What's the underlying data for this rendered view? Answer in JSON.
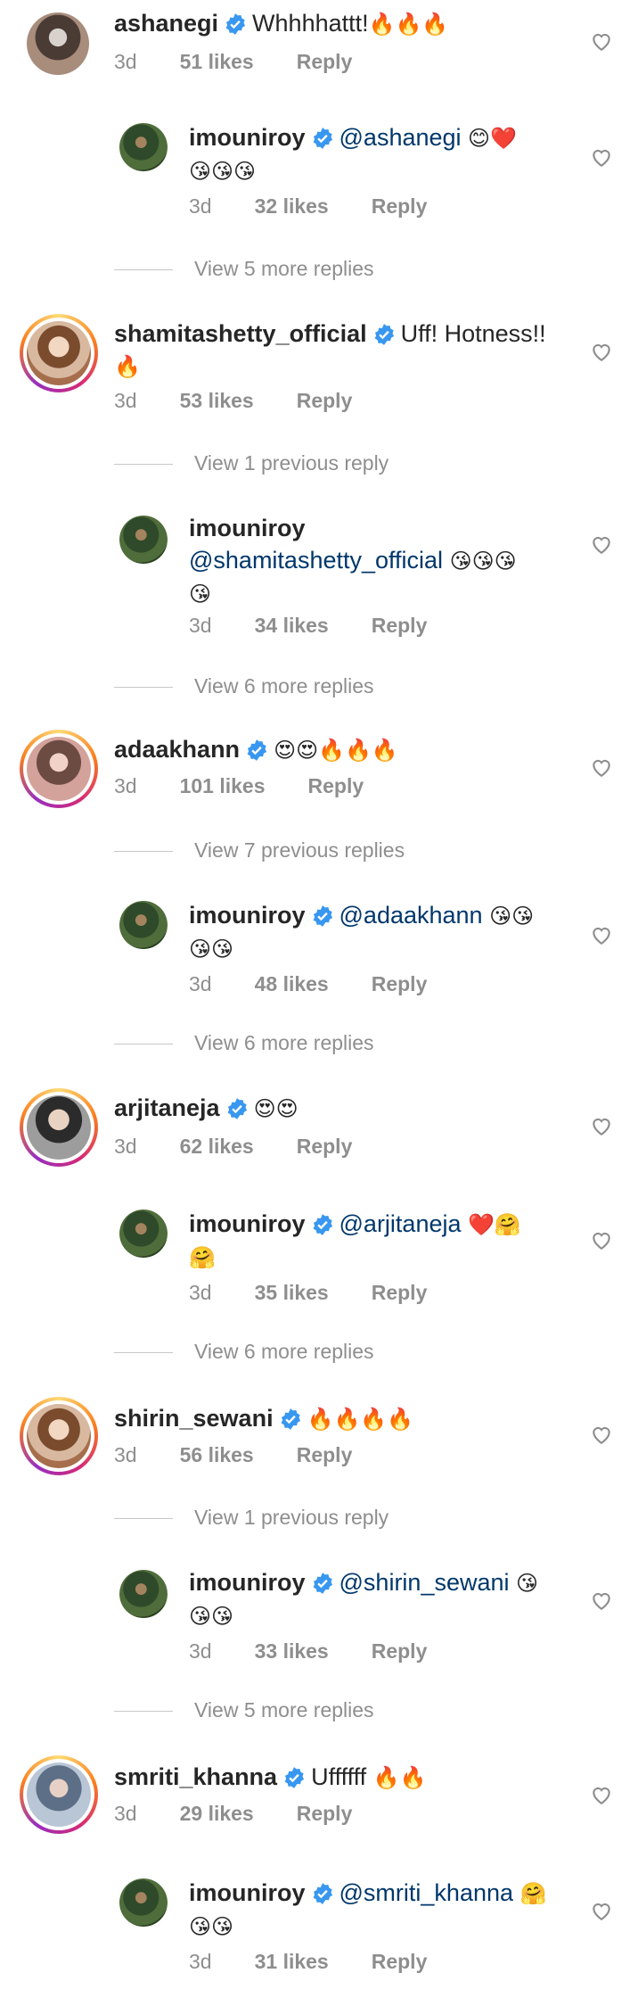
{
  "threads": [
    {
      "comment": {
        "username": "ashanegi",
        "text": "Whhhhattt!",
        "emoji": "🔥🔥🔥",
        "time": "3d",
        "likes": "51 likes",
        "reply": "Reply"
      },
      "reply": {
        "username": "imouniroy",
        "mention": "@ashanegi",
        "emoji_inline": "😊❤️",
        "emoji_line2": "😘😘😘",
        "time": "3d",
        "likes": "32 likes",
        "reply": "Reply"
      },
      "view_more_after": "View 5 more replies"
    },
    {
      "comment": {
        "username": "shamitashetty_official",
        "text": "Uff! Hotness!!",
        "emoji_line2": "🔥",
        "time": "3d",
        "likes": "53 likes",
        "reply": "Reply"
      },
      "view_previous": "View 1 previous reply",
      "reply": {
        "username": "imouniroy",
        "mention": "@shamitashetty_official",
        "emoji_inline": "😘😘😘",
        "emoji_line2": "😘",
        "time": "3d",
        "likes": "34 likes",
        "reply": "Reply"
      },
      "view_more_after": "View 6 more replies"
    },
    {
      "comment": {
        "username": "adaakhann",
        "emoji": "😍😍🔥🔥🔥",
        "time": "3d",
        "likes": "101 likes",
        "reply": "Reply"
      },
      "view_previous": "View 7 previous replies",
      "reply": {
        "username": "imouniroy",
        "mention": "@adaakhann",
        "emoji_inline": "😘😘",
        "emoji_line2": "😘😘",
        "time": "3d",
        "likes": "48 likes",
        "reply": "Reply"
      },
      "view_more_after": "View 6 more replies"
    },
    {
      "comment": {
        "username": "arjitaneja",
        "emoji": "😍😍",
        "time": "3d",
        "likes": "62 likes",
        "reply": "Reply"
      },
      "reply": {
        "username": "imouniroy",
        "mention": "@arjitaneja",
        "emoji_inline": "❤️🤗",
        "emoji_line2": "🤗",
        "time": "3d",
        "likes": "35 likes",
        "reply": "Reply"
      },
      "view_more_after": "View 6 more replies"
    },
    {
      "comment": {
        "username": "shirin_sewani",
        "emoji": "🔥🔥🔥🔥",
        "time": "3d",
        "likes": "56 likes",
        "reply": "Reply"
      },
      "view_previous": "View 1 previous reply",
      "reply": {
        "username": "imouniroy",
        "mention": "@shirin_sewani",
        "emoji_inline": "😘",
        "emoji_line2": "😘😘",
        "time": "3d",
        "likes": "33 likes",
        "reply": "Reply"
      },
      "view_more_after": "View 5 more replies"
    },
    {
      "comment": {
        "username": "smriti_khanna",
        "text": "Uffffff",
        "emoji": "🔥🔥",
        "time": "3d",
        "likes": "29 likes",
        "reply": "Reply"
      },
      "reply": {
        "username": "imouniroy",
        "mention": "@smriti_khanna",
        "emoji_inline": "🤗",
        "emoji_line2": "😘😘",
        "time": "3d",
        "likes": "31 likes",
        "reply": "Reply"
      }
    }
  ],
  "icons": {
    "verified": "verified-badge-icon",
    "heart": "heart-outline-icon"
  },
  "colors": {
    "verified_blue": "#3897f0",
    "mention": "#00376b",
    "meta_gray": "#8e8e8e"
  }
}
